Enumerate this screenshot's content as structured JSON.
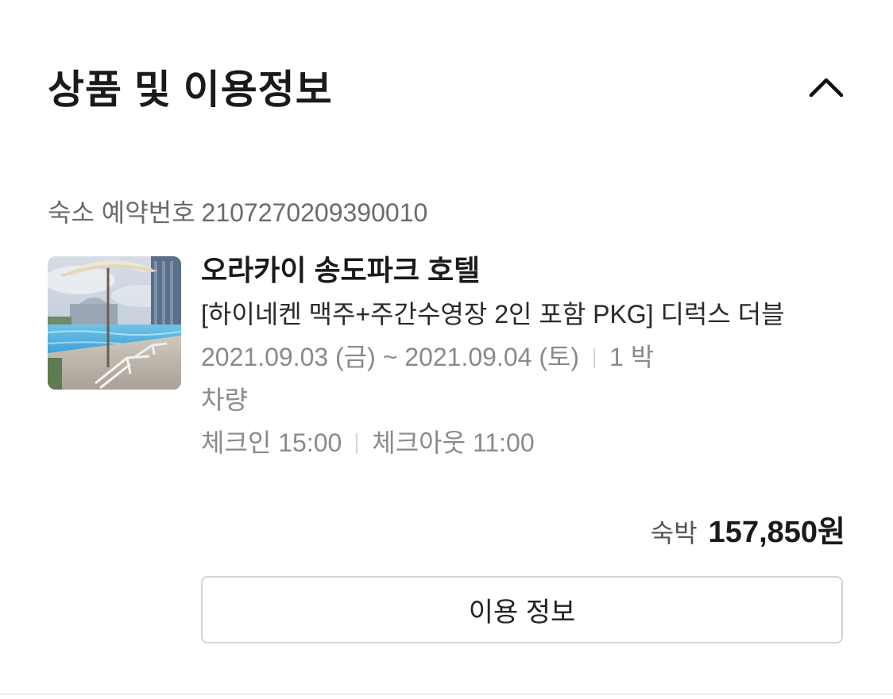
{
  "section": {
    "title": "상품 및 이용정보",
    "toggle_icon": "chevron-up-icon"
  },
  "reservation": {
    "label": "숙소 예약번호",
    "number": "2107270209390010"
  },
  "product": {
    "thumbnail": "hotel-pool-photo",
    "hotel_name": "오라카이 송도파크 호텔",
    "room_name": "[하이네켄 맥주+주간수영장 2인 포함 PKG] 디럭스 더블",
    "date_range": "2021.09.03 (금) ~ 2021.09.04 (토)",
    "nights": "1 박",
    "transport": "차량",
    "checkin": "체크인 15:00",
    "checkout": "체크아웃 11:00"
  },
  "price": {
    "label": "숙박",
    "value": "157,850원"
  },
  "actions": {
    "usage_info_label": "이용 정보"
  },
  "colors": {
    "text_primary": "#1a1a1a",
    "text_muted": "#8a8a8a",
    "border": "#d4d4d4"
  }
}
